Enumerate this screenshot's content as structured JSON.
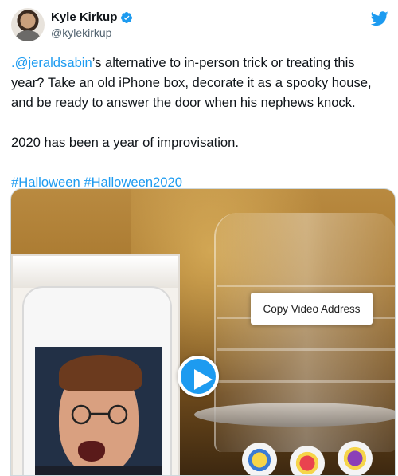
{
  "author": {
    "name": "Kyle Kirkup",
    "handle": "@kylekirkup"
  },
  "tweet": {
    "mention": ".@jeraldsabin",
    "line1_rest": "’s alternative to in-person trick or treating this year? Take an old iPhone box, decorate it as a spooky house, and be ready to answer the door when his nephews knock.",
    "line2": "2020 has been a year of improvisation.",
    "hashtag1": "#Halloween",
    "hashtag2": "#Halloween2020"
  },
  "media": {
    "context_menu_item": "Copy Video Address"
  },
  "colors": {
    "accent": "#1d9bf0",
    "text": "#0f1419",
    "secondary": "#536471"
  },
  "icons": {
    "verified": "verified-badge-icon",
    "logo": "twitter-bird-icon",
    "play": "play-icon"
  }
}
